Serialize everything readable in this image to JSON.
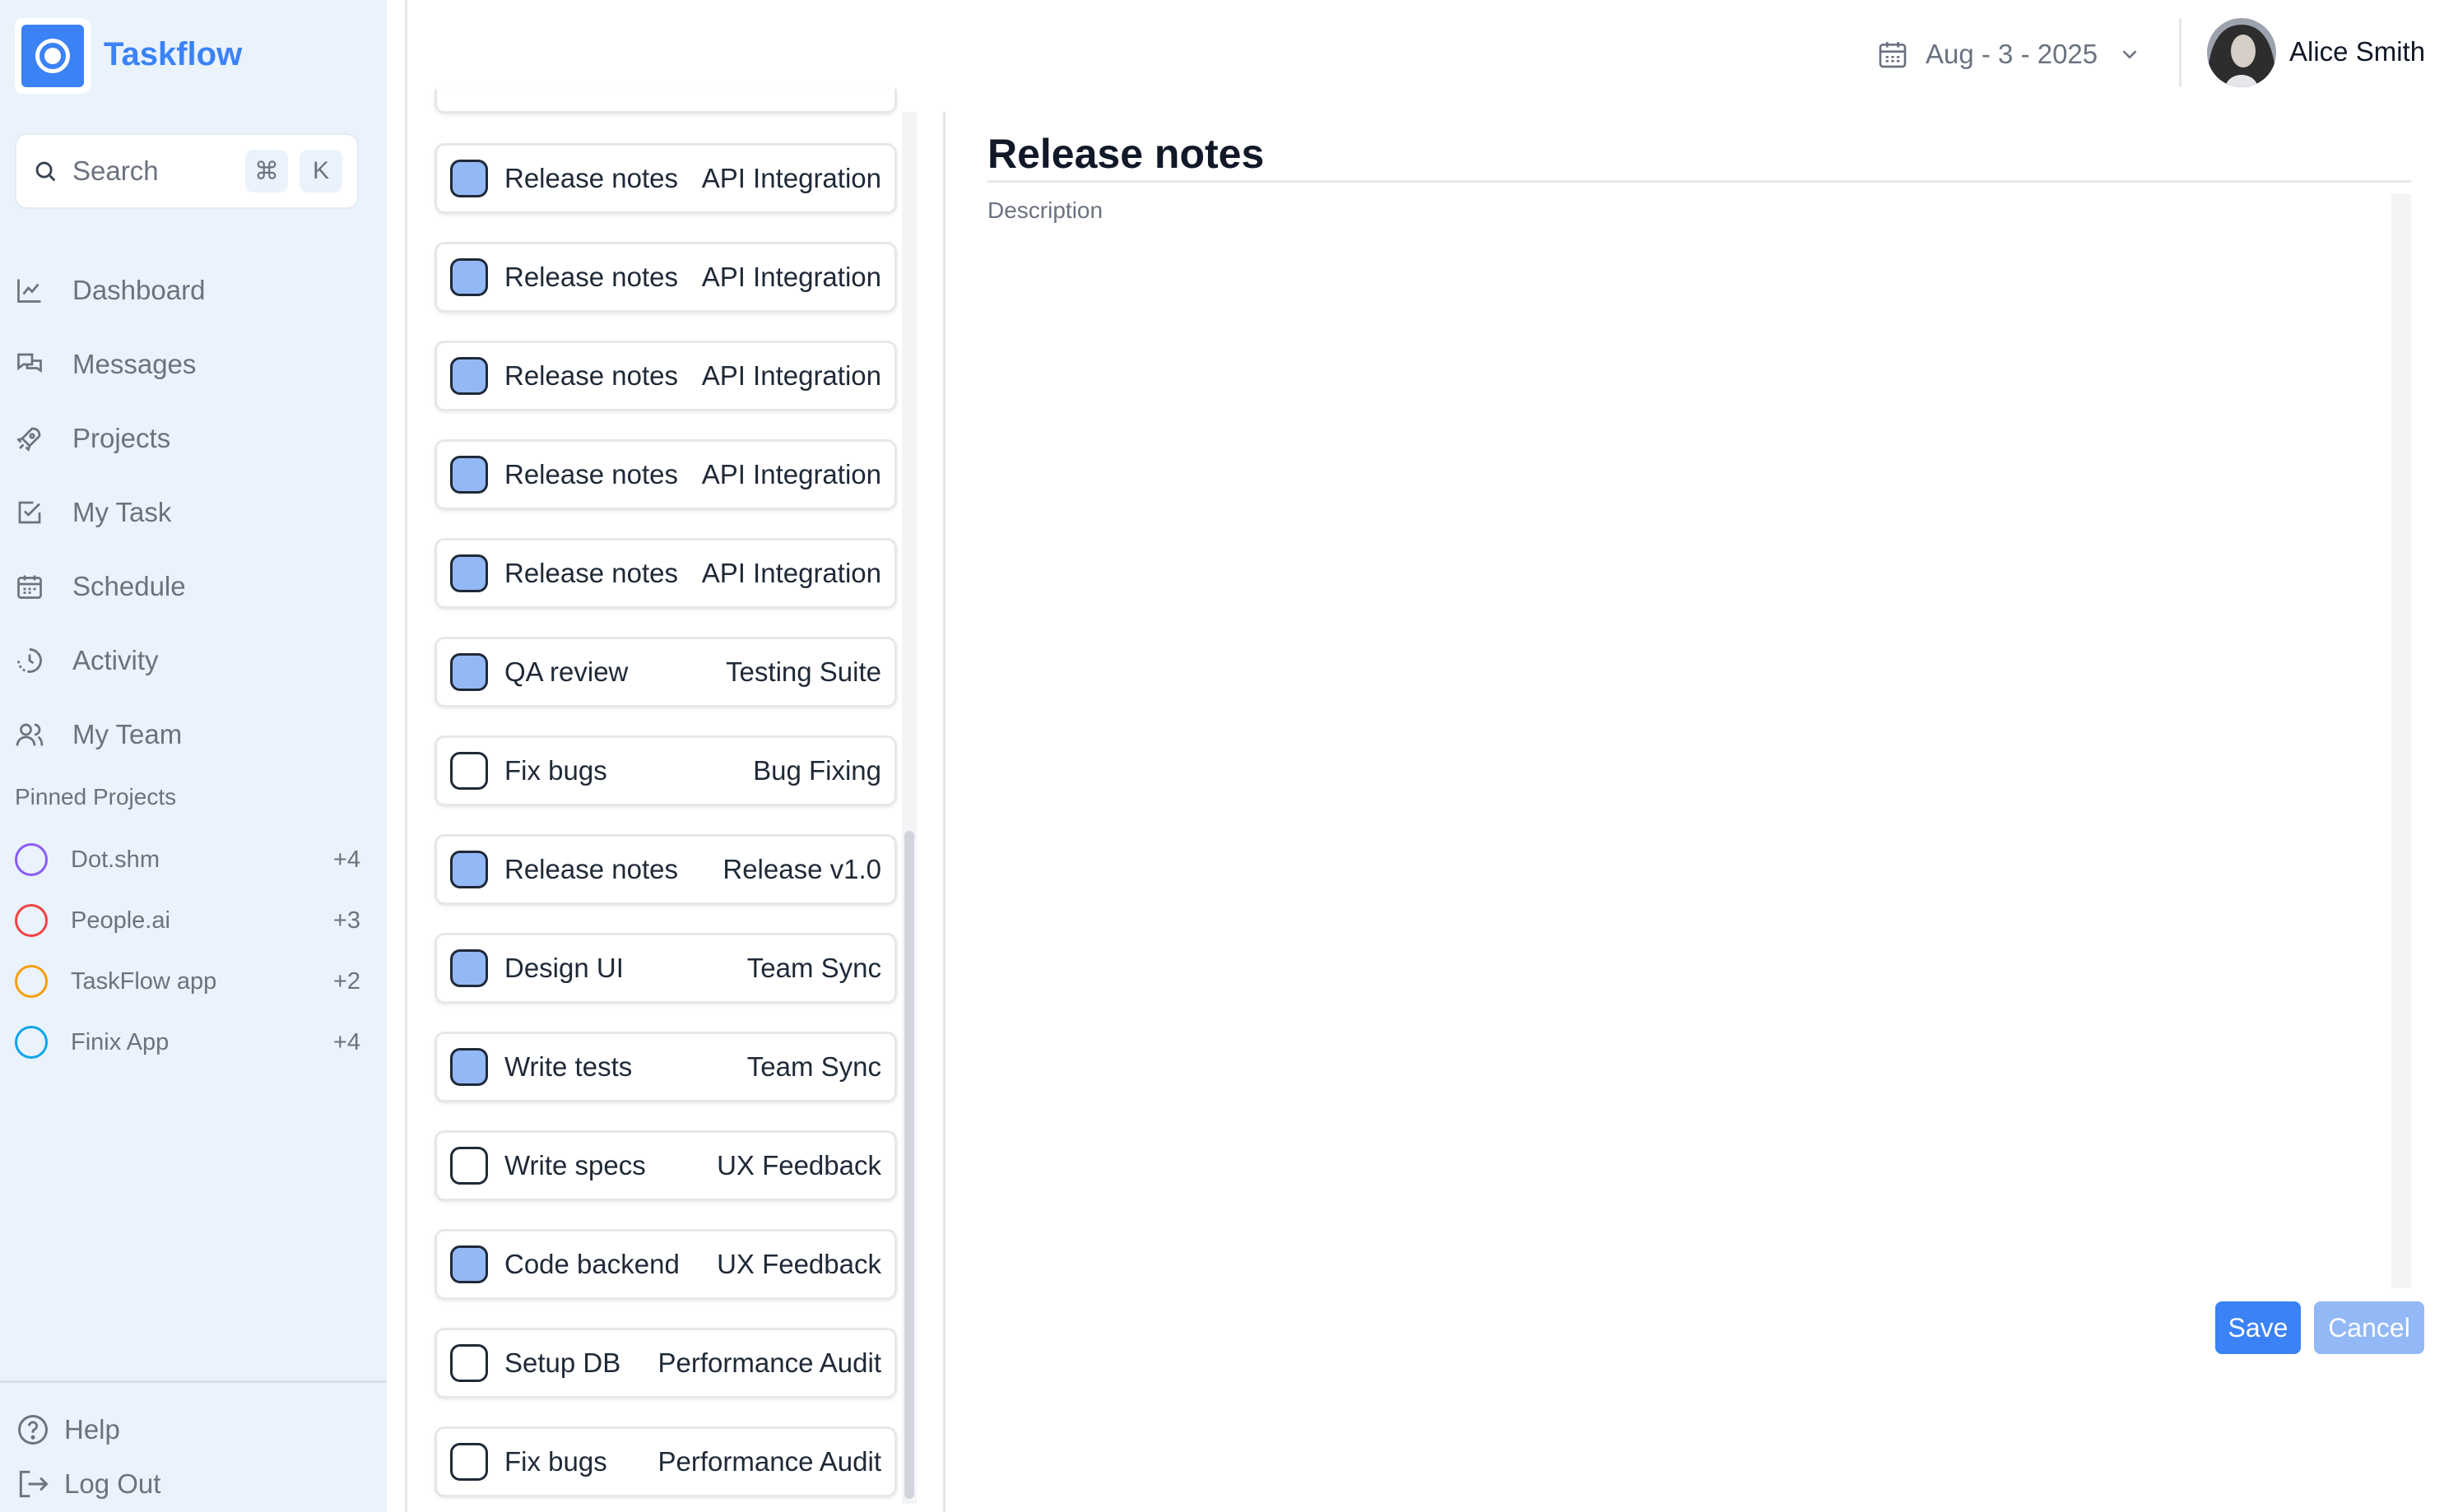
{
  "app": {
    "name": "Taskflow"
  },
  "search": {
    "placeholder": "Search",
    "shortcut_cmd": "⌘",
    "shortcut_key": "K"
  },
  "nav": [
    {
      "label": "Dashboard",
      "icon": "chart-icon"
    },
    {
      "label": "Messages",
      "icon": "chat-icon"
    },
    {
      "label": "Projects",
      "icon": "rocket-icon"
    },
    {
      "label": "My Task",
      "icon": "checkbox-icon"
    },
    {
      "label": "Schedule",
      "icon": "calendar-icon"
    },
    {
      "label": "Activity",
      "icon": "history-icon"
    },
    {
      "label": "My Team",
      "icon": "users-icon"
    }
  ],
  "pinned": {
    "title": "Pinned Projects",
    "items": [
      {
        "name": "Dot.shm",
        "count": "+4",
        "color": "#8b5cf6"
      },
      {
        "name": "People.ai",
        "count": "+3",
        "color": "#ef4444"
      },
      {
        "name": "TaskFlow app",
        "count": "+2",
        "color": "#f59e0b"
      },
      {
        "name": "Finix App",
        "count": "+4",
        "color": "#0ea5e9"
      }
    ]
  },
  "bottom": {
    "help": "Help",
    "logout": "Log Out"
  },
  "header": {
    "date": "Aug - 3 - 2025",
    "user_name": "Alice Smith"
  },
  "tasks": [
    {
      "title": "Release notes",
      "project": "API Integration",
      "checked": true
    },
    {
      "title": "Release notes",
      "project": "API Integration",
      "checked": true
    },
    {
      "title": "Release notes",
      "project": "API Integration",
      "checked": true
    },
    {
      "title": "Release notes",
      "project": "API Integration",
      "checked": true
    },
    {
      "title": "Release notes",
      "project": "API Integration",
      "checked": true
    },
    {
      "title": "QA review",
      "project": "Testing Suite",
      "checked": true
    },
    {
      "title": "Fix bugs",
      "project": "Bug Fixing",
      "checked": false
    },
    {
      "title": "Release notes",
      "project": "Release v1.0",
      "checked": true
    },
    {
      "title": "Design UI",
      "project": "Team Sync",
      "checked": true
    },
    {
      "title": "Write tests",
      "project": "Team Sync",
      "checked": true
    },
    {
      "title": "Write specs",
      "project": "UX Feedback",
      "checked": false
    },
    {
      "title": "Code backend",
      "project": "UX Feedback",
      "checked": true
    },
    {
      "title": "Setup DB",
      "project": "Performance Audit",
      "checked": false
    },
    {
      "title": "Fix bugs",
      "project": "Performance Audit",
      "checked": false
    }
  ],
  "detail": {
    "title": "Release notes",
    "description_placeholder": "Description",
    "save_label": "Save",
    "cancel_label": "Cancel"
  },
  "colors": {
    "accent": "#3b82f6",
    "accent_light": "#93b8f6",
    "sidebar_bg": "#eaf2fc"
  }
}
